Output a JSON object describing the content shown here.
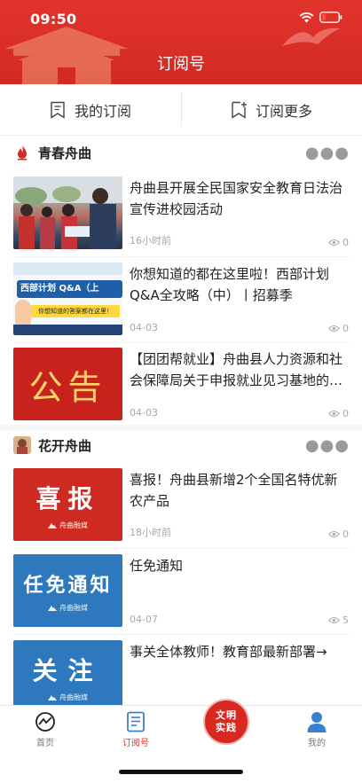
{
  "status_bar": {
    "time": "09:50"
  },
  "header": {
    "title": "订阅号"
  },
  "subscribe": {
    "my_label": "我的订阅",
    "more_label": "订阅更多"
  },
  "channels": [
    {
      "name": "青春舟曲",
      "articles": [
        {
          "title": "舟曲县开展全民国家安全教育日法治宣传进校园活动",
          "time": "16小时前",
          "views": "0"
        },
        {
          "title": "你想知道的都在这里啦！西部计划Q&A全攻略（中）丨招募季",
          "time": "04-03",
          "views": "0",
          "thumb_text": "西部计划 Q&A（上",
          "thumb_sub": "你想知道的答案都在这里！"
        },
        {
          "title": "【团团帮就业】舟曲县人力资源和社会保障局关于申报就业见习基地的通知",
          "time": "04-03",
          "views": "0",
          "thumb_text": "公告"
        }
      ]
    },
    {
      "name": "花开舟曲",
      "articles": [
        {
          "title": "喜报！舟曲县新增2个全国名特优新农产品",
          "time": "18小时前",
          "views": "0",
          "thumb_text": "喜报",
          "thumb_sub": "舟曲融媒"
        },
        {
          "title": "任免通知",
          "time": "04-07",
          "views": "5",
          "thumb_text": "任免通知",
          "thumb_sub": "舟曲融媒"
        },
        {
          "title": "事关全体教师！教育部最新部署→",
          "thumb_text": "关注",
          "thumb_sub": "舟曲融媒"
        }
      ]
    }
  ],
  "tabbar": {
    "home": "首页",
    "subscription": "订阅号",
    "center_line1": "文明",
    "center_line2": "实践",
    "mine": "我的"
  },
  "colors": {
    "brand_red": "#e0332c",
    "thumb_red": "#d0251f",
    "thumb_blue": "#2e78bd"
  }
}
